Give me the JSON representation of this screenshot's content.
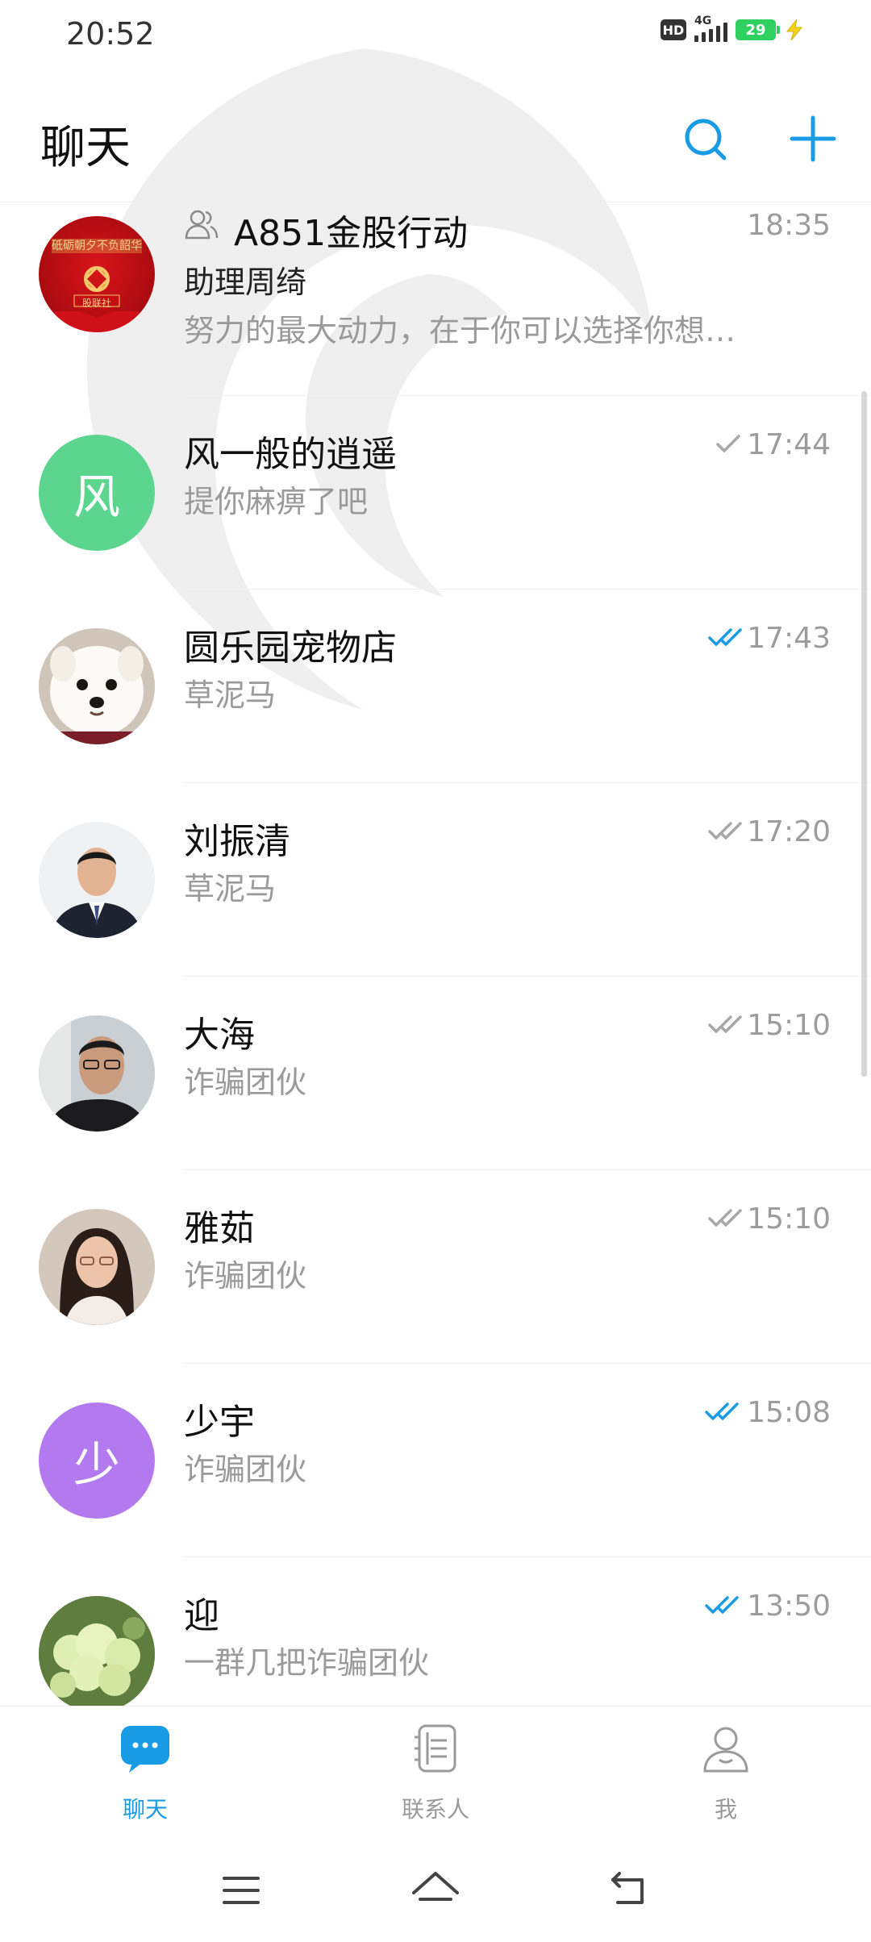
{
  "status_bar": {
    "time": "20:52",
    "hd_label": "HD",
    "network": "4G",
    "battery": "29",
    "battery_color": "#2fcf60"
  },
  "header": {
    "title": "聊天",
    "search_icon": "search-icon",
    "add_icon": "plus-icon",
    "accent_color": "#1a9be6"
  },
  "chats": [
    {
      "name": "A851金股行动",
      "is_group": true,
      "sender": "助理周绮",
      "preview": "努力的最大动力，在于你可以选择你想…",
      "time": "18:35",
      "status": "none",
      "avatar_text": "",
      "avatar_caption": "砥砺朝夕不负韶华",
      "avatar_sub": "股联社"
    },
    {
      "name": "风一般的逍遥",
      "preview": "提你麻痹了吧",
      "time": "17:44",
      "status": "sent",
      "avatar_text": "风",
      "avatar_color": "#5cd68e"
    },
    {
      "name": "圆乐园宠物店",
      "preview": "草泥马",
      "time": "17:43",
      "status": "read"
    },
    {
      "name": "刘振清",
      "preview": "草泥马",
      "time": "17:20",
      "status": "delivered"
    },
    {
      "name": "大海",
      "preview": "诈骗团伙",
      "time": "15:10",
      "status": "delivered"
    },
    {
      "name": "雅茹",
      "preview": "诈骗团伙",
      "time": "15:10",
      "status": "delivered"
    },
    {
      "name": "少宇",
      "preview": "诈骗团伙",
      "time": "15:08",
      "status": "read",
      "avatar_text": "少",
      "avatar_color": "#b37af0"
    },
    {
      "name": "迎",
      "preview": "一群几把诈骗团伙",
      "time": "13:50",
      "status": "read"
    }
  ],
  "bottom_nav": {
    "tabs": [
      {
        "label": "聊天",
        "icon": "chat-bubble-icon",
        "active": true
      },
      {
        "label": "联系人",
        "icon": "contacts-icon",
        "active": false
      },
      {
        "label": "我",
        "icon": "profile-icon",
        "active": false
      }
    ]
  },
  "system_nav": {
    "menu_icon": "menu-icon",
    "home_icon": "home-icon",
    "back_icon": "back-icon"
  }
}
